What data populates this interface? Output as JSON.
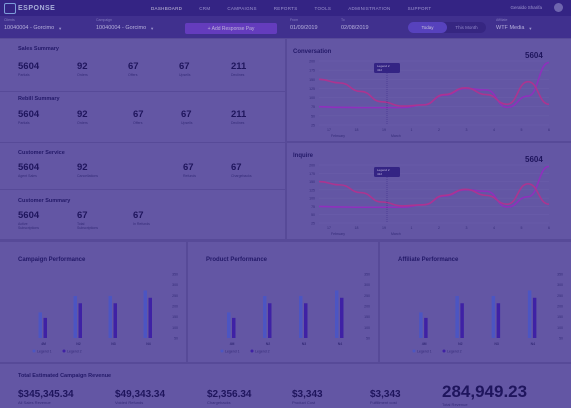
{
  "app": {
    "logo_text": "ESPONSE"
  },
  "nav": {
    "items": [
      "DASHBOARD",
      "CRM",
      "CAMPAIGNS",
      "REPORTS",
      "TOOLS",
      "ADMINISTRATION",
      "SUPPORT"
    ],
    "active": 0
  },
  "user": {
    "name": "Geraldo Sharifa"
  },
  "filters": {
    "company": {
      "label": "Clients",
      "value": "10040004 - Gorcimo"
    },
    "campaign": {
      "label": "Campaign",
      "value": "10040004 - Gorcimo"
    },
    "add_button": "+ Add Response Pay",
    "from": {
      "label": "From",
      "value": "01/09/2019"
    },
    "to": {
      "label": "To",
      "value": "02/08/2019"
    },
    "toggle": [
      "Today",
      "This Month"
    ],
    "toggle_active": 0,
    "affiliate": {
      "label": "Affiliate",
      "value": "WTF Media"
    }
  },
  "sales_summary": {
    "title": "Sales Summary",
    "stats": [
      {
        "value": "5604",
        "label": "Partials"
      },
      {
        "value": "92",
        "label": "Orders"
      },
      {
        "value": "67",
        "label": "Offers"
      },
      {
        "value": "67",
        "label": "Upsells"
      },
      {
        "value": "211",
        "label": "Declines"
      }
    ]
  },
  "rebill_summary": {
    "title": "Rebill Summary",
    "stats": [
      {
        "value": "5604",
        "label": "Partials"
      },
      {
        "value": "92",
        "label": "Orders"
      },
      {
        "value": "67",
        "label": "Offers"
      },
      {
        "value": "67",
        "label": "Upsells"
      },
      {
        "value": "211",
        "label": "Declines"
      }
    ]
  },
  "customer_service": {
    "title": "Customer Service",
    "stats": [
      {
        "value": "5604",
        "label": "Agent Sales"
      },
      {
        "value": "92",
        "label": "Cancellations"
      },
      {
        "value": "67",
        "label": "Refunds"
      },
      {
        "value": "67",
        "label": "Chargebacks"
      }
    ]
  },
  "customer_summary": {
    "title": "Customer Summary",
    "stats": [
      {
        "value": "5604",
        "label": "Active\nSubscriptions"
      },
      {
        "value": "67",
        "label": "Total\nSubscriptions"
      },
      {
        "value": "67",
        "label": "In Refunds"
      }
    ]
  },
  "chart_data": [
    {
      "type": "line",
      "title": "Conversation",
      "headline": "5604",
      "y_ticks": [
        "200",
        "175",
        "150",
        "125",
        "100",
        "75",
        "50",
        "25"
      ],
      "x_ticks": [
        "17",
        "18",
        "19",
        "1",
        "2",
        "3",
        "4",
        "5",
        "6"
      ],
      "x_months": [
        "February",
        "March"
      ],
      "tooltip": [
        "Legend 2",
        "412"
      ],
      "colors": [
        "#b83ad8",
        "#e0409a"
      ],
      "series": [
        {
          "values": [
            60,
            58,
            57,
            57,
            57,
            66,
            98,
            120,
            115,
            58,
            95,
            205
          ]
        },
        {
          "values": [
            150,
            138,
            110,
            76,
            62,
            66,
            100,
            122,
            100,
            68,
            142,
            68
          ]
        }
      ]
    },
    {
      "type": "line",
      "title": "Inquire",
      "headline": "5604",
      "y_ticks": [
        "200",
        "175",
        "150",
        "125",
        "100",
        "75",
        "50",
        "25"
      ],
      "x_ticks": [
        "17",
        "18",
        "19",
        "1",
        "2",
        "3",
        "4",
        "5",
        "6"
      ],
      "x_months": [
        "February",
        "March"
      ],
      "tooltip": [
        "Legend 2",
        "412"
      ],
      "colors": [
        "#b83ad8",
        "#e0409a"
      ],
      "series": [
        {
          "values": [
            60,
            58,
            57,
            57,
            57,
            66,
            98,
            120,
            115,
            58,
            95,
            205
          ]
        },
        {
          "values": [
            150,
            138,
            110,
            76,
            62,
            66,
            100,
            122,
            100,
            68,
            142,
            68
          ]
        }
      ]
    },
    {
      "type": "bar",
      "title": "Campaign Performance",
      "categories": [
        "4M",
        "N2",
        "N3",
        "N4"
      ],
      "y_ticks": [
        "350",
        "300",
        "250",
        "200",
        "150",
        "100",
        "50"
      ],
      "legend": [
        "Legend 1",
        "Legend 2"
      ],
      "colors": [
        "#5a6ee0",
        "#4826b8"
      ],
      "series": [
        {
          "name": "Legend 1",
          "values": [
            140,
            230,
            230,
            260
          ]
        },
        {
          "name": "Legend 2",
          "values": [
            110,
            190,
            190,
            220
          ]
        }
      ]
    },
    {
      "type": "bar",
      "title": "Product Performance",
      "categories": [
        "4M",
        "N2",
        "N3",
        "N4"
      ],
      "y_ticks": [
        "350",
        "300",
        "250",
        "200",
        "150",
        "100",
        "50"
      ],
      "legend": [
        "Legend 1",
        "Legend 2"
      ],
      "colors": [
        "#5a6ee0",
        "#4826b8"
      ],
      "series": [
        {
          "name": "Legend 1",
          "values": [
            140,
            230,
            230,
            260
          ]
        },
        {
          "name": "Legend 2",
          "values": [
            110,
            190,
            190,
            220
          ]
        }
      ]
    },
    {
      "type": "bar",
      "title": "Affiliate Performance",
      "categories": [
        "4M",
        "N2",
        "N3",
        "N4"
      ],
      "y_ticks": [
        "350",
        "300",
        "250",
        "200",
        "150",
        "100",
        "50"
      ],
      "legend": [
        "Legend 1",
        "Legend 2"
      ],
      "colors": [
        "#5a6ee0",
        "#4826b8"
      ],
      "series": [
        {
          "name": "Legend 1",
          "values": [
            140,
            230,
            230,
            260
          ]
        },
        {
          "name": "Legend 2",
          "values": [
            110,
            190,
            190,
            220
          ]
        }
      ]
    }
  ],
  "revenue": {
    "title": "Total Estimated Campaign Revenue",
    "items": [
      {
        "value": "$345,345.34",
        "label": "All Sales Revenue"
      },
      {
        "value": "$49,343.34",
        "label": "Voided Refunds"
      },
      {
        "value": "$2,356.34",
        "label": "Chargebacks"
      },
      {
        "value": "$3,343",
        "label": "Product Cost"
      },
      {
        "value": "$3,343",
        "label": "Fulfillment cost"
      }
    ],
    "total": {
      "value": "284,949.23",
      "label": "Total Revenue"
    }
  }
}
